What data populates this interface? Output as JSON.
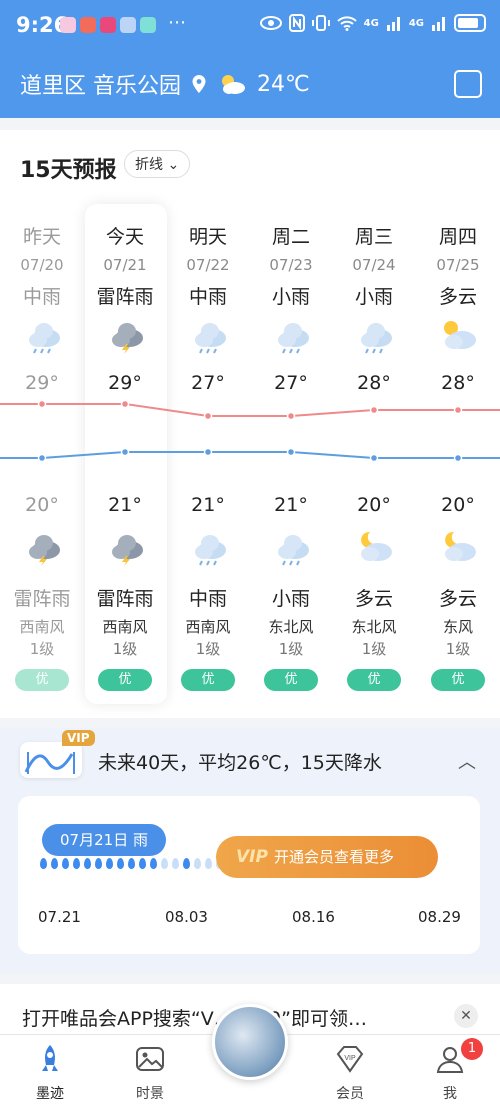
{
  "status_bar": {
    "time": "9:26",
    "more": "⋯",
    "network": "4G",
    "network2": "4G"
  },
  "header": {
    "location": "道里区 音乐公园",
    "temperature": "24℃",
    "location_icon": "location-pin-icon",
    "weather_icon": "partly-cloudy-icon",
    "share_icon": "share-icon"
  },
  "forecast": {
    "title": "15天预报",
    "view_mode": "折线",
    "days": [
      {
        "day": "昨天",
        "date": "07/20",
        "cond_day": "中雨",
        "icon_day": "rain",
        "high": "29°",
        "low": "20°",
        "icon_night": "thunder",
        "cond_night": "雷阵雨",
        "wind": "西南风",
        "level": "1级",
        "aqi": "优",
        "past": true
      },
      {
        "day": "今天",
        "date": "07/21",
        "cond_day": "雷阵雨",
        "icon_day": "thunder",
        "high": "29°",
        "low": "21°",
        "icon_night": "thunder",
        "cond_night": "雷阵雨",
        "wind": "西南风",
        "level": "1级",
        "aqi": "优",
        "past": false
      },
      {
        "day": "明天",
        "date": "07/22",
        "cond_day": "中雨",
        "icon_day": "rain",
        "high": "27°",
        "low": "21°",
        "icon_night": "rain",
        "cond_night": "中雨",
        "wind": "西南风",
        "level": "1级",
        "aqi": "优",
        "past": false
      },
      {
        "day": "周二",
        "date": "07/23",
        "cond_day": "小雨",
        "icon_day": "rain",
        "high": "27°",
        "low": "21°",
        "icon_night": "rain",
        "cond_night": "小雨",
        "wind": "东北风",
        "level": "1级",
        "aqi": "优",
        "past": false
      },
      {
        "day": "周三",
        "date": "07/24",
        "cond_day": "小雨",
        "icon_day": "rain",
        "high": "28°",
        "low": "20°",
        "icon_night": "cloudy-night",
        "cond_night": "多云",
        "wind": "东北风",
        "level": "1级",
        "aqi": "优",
        "past": false
      },
      {
        "day": "周四",
        "date": "07/25",
        "cond_day": "多云",
        "icon_day": "sun-cloud",
        "high": "28°",
        "low": "20°",
        "icon_night": "cloudy-night",
        "cond_night": "多云",
        "wind": "东风",
        "level": "1级",
        "aqi": "优",
        "past": false
      }
    ],
    "colors": {
      "high_line": "#ee8a8a",
      "low_line": "#5b9fe0",
      "aqi": "#3ec49a"
    }
  },
  "forty_day": {
    "vip_tag": "VIP",
    "title": "未来40天，平均26℃，15天降水",
    "bubble": "07月21日 雨",
    "vip_button_prefix": "VIP",
    "vip_button": "开通会员查看更多",
    "dates": [
      "07.21",
      "08.03",
      "08.16",
      "08.29"
    ]
  },
  "ad": {
    "text": "打开唯品会APP搜索“V…2020”即可领…",
    "close": "✕"
  },
  "nav": {
    "items": [
      {
        "label": "墨迹",
        "icon": "rocket-icon"
      },
      {
        "label": "时景",
        "icon": "picture-icon"
      },
      {
        "label": "会员",
        "icon": "vip-diamond-icon"
      },
      {
        "label": "我",
        "icon": "user-icon"
      }
    ],
    "badge": "1"
  }
}
